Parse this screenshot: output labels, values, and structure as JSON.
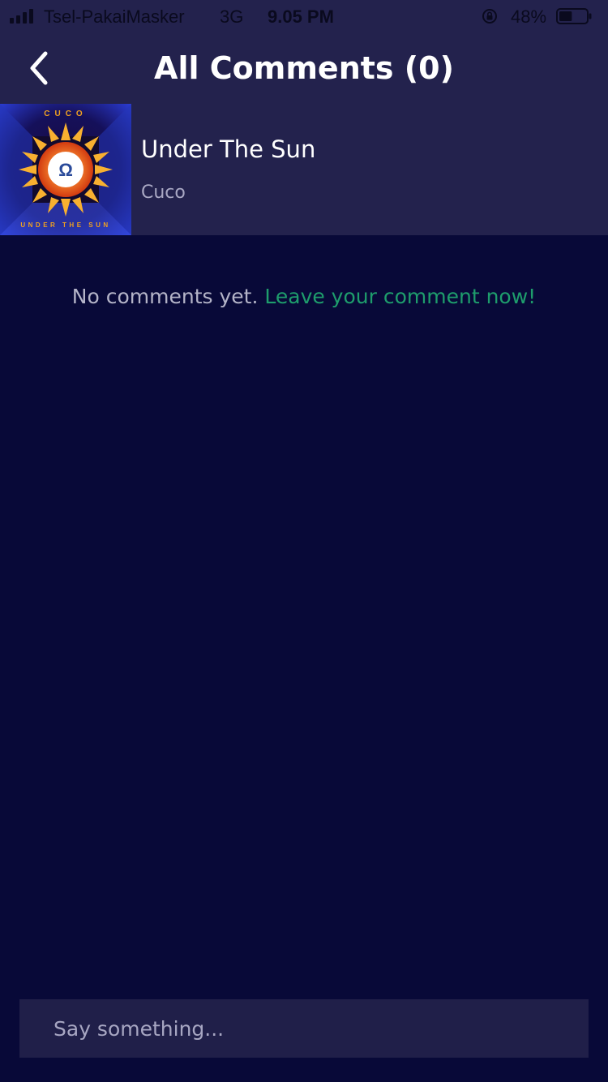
{
  "status_bar": {
    "carrier": "Tsel-PakaiMasker",
    "network": "3G",
    "time": "9.05 PM",
    "battery_percent": "48%",
    "battery_level": 0.48,
    "signal_bars": 4
  },
  "header": {
    "title": "All Comments (0)",
    "back_icon": "chevron-left-icon"
  },
  "song": {
    "title": "Under The Sun",
    "artist": "Cuco",
    "album_art": {
      "top_text": "CUCO",
      "bottom_text": "UNDER THE SUN"
    }
  },
  "empty_state": {
    "message": "No comments yet.",
    "link_text": "Leave your comment now!"
  },
  "comment_input": {
    "placeholder": "Say something..."
  },
  "colors": {
    "background": "#080938",
    "header_background": "#23224d",
    "accent_green": "#1e9d6c",
    "muted_text": "#b4b4c8"
  }
}
